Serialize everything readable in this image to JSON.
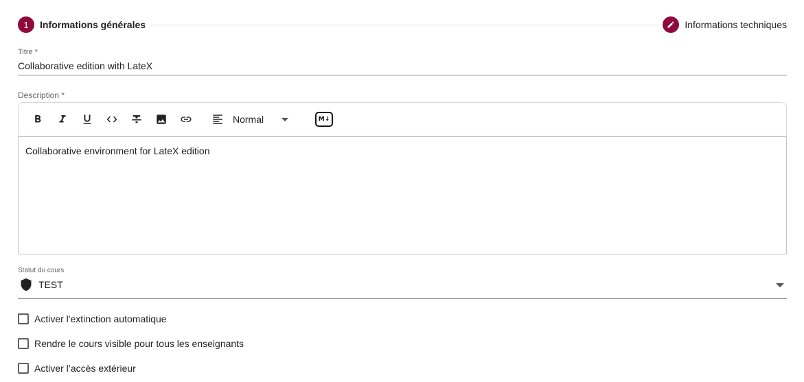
{
  "stepper": {
    "steps": [
      {
        "number": "1",
        "label": "Informations générales",
        "state": "active"
      },
      {
        "icon": "pencil-icon",
        "label": "Informations techniques",
        "state": "edit"
      }
    ],
    "accent_color": "#8e0a3e"
  },
  "form": {
    "titre": {
      "label": "Titre *",
      "value": "Collaborative edition with LateX"
    },
    "description": {
      "label": "Description *",
      "toolbar": {
        "buttons": [
          "bold-icon",
          "italic-icon",
          "underline-icon",
          "code-icon",
          "strikethrough-icon",
          "image-icon",
          "link-icon",
          "align-left-icon"
        ],
        "heading_select": "Normal",
        "markdown_label": "M↓"
      },
      "value": "Collaborative environment for LateX edition"
    },
    "statut": {
      "label": "Statut du cours",
      "value": "TEST",
      "icon": "shield-icon"
    },
    "checkboxes": [
      {
        "label": "Activer l'extinction automatique",
        "checked": false
      },
      {
        "label": "Rendre le cours visible pour tous les enseignants",
        "checked": false
      },
      {
        "label": "Activer l’accès extérieur",
        "checked": false
      }
    ]
  }
}
